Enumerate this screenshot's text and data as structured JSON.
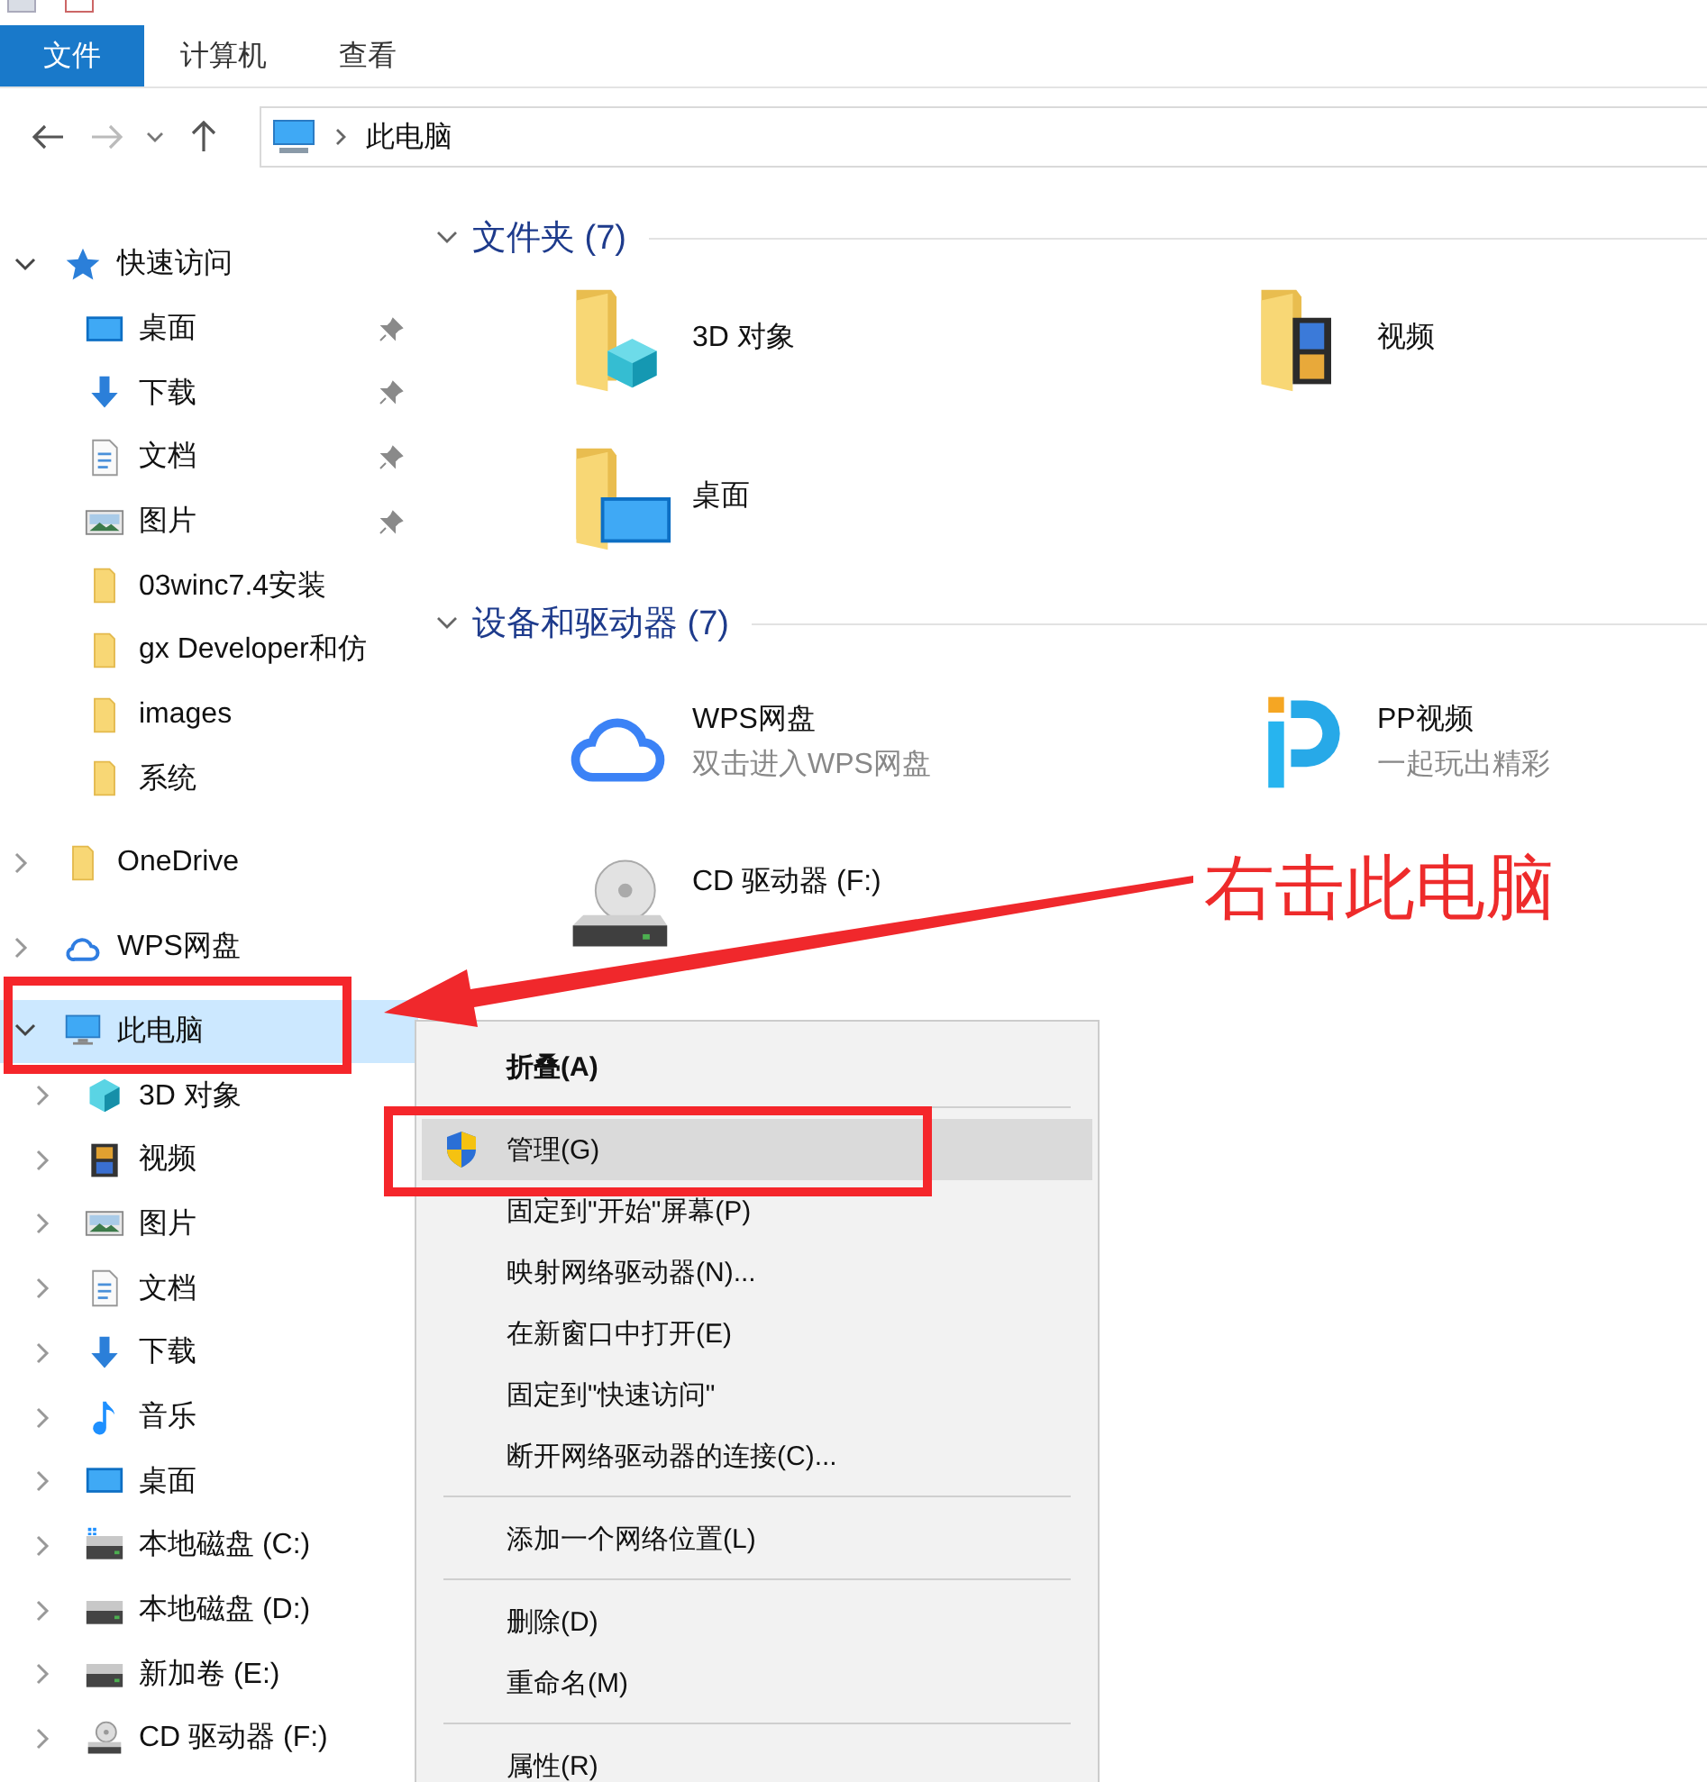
{
  "ribbon": {
    "tabs": [
      {
        "label": "文件",
        "selected": true
      },
      {
        "label": "计算机",
        "selected": false
      },
      {
        "label": "查看",
        "selected": false
      }
    ]
  },
  "address_bar": {
    "segments": [
      "此电脑"
    ]
  },
  "sidebar": {
    "items": [
      {
        "label": "快速访问",
        "kind": "star",
        "expanded": true,
        "selected": false,
        "children": [
          {
            "label": "桌面",
            "kind": "desktop",
            "pinned": true,
            "selected": false
          },
          {
            "label": "下载",
            "kind": "download",
            "pinned": true,
            "selected": false
          },
          {
            "label": "文档",
            "kind": "document",
            "pinned": true,
            "selected": false
          },
          {
            "label": "图片",
            "kind": "picture",
            "pinned": true,
            "selected": false
          },
          {
            "label": "03winc7.4安装",
            "kind": "folder",
            "pinned": false,
            "selected": false
          },
          {
            "label": "gx Developer和仿",
            "kind": "folder",
            "pinned": false,
            "selected": false
          },
          {
            "label": "images",
            "kind": "folder",
            "pinned": false,
            "selected": false
          },
          {
            "label": "系统",
            "kind": "folder",
            "pinned": false,
            "selected": false
          }
        ]
      },
      {
        "label": "OneDrive",
        "kind": "folder",
        "expanded": false,
        "selected": false
      },
      {
        "label": "WPS网盘",
        "kind": "cloud",
        "expanded": false,
        "selected": false
      },
      {
        "label": "此电脑",
        "kind": "pc",
        "expanded": true,
        "selected": true,
        "children": [
          {
            "label": "3D 对象",
            "kind": "cube",
            "expanded": false,
            "selected": false
          },
          {
            "label": "视频",
            "kind": "film",
            "expanded": false,
            "selected": false
          },
          {
            "label": "图片",
            "kind": "picture",
            "expanded": false,
            "selected": false
          },
          {
            "label": "文档",
            "kind": "document",
            "expanded": false,
            "selected": false
          },
          {
            "label": "下载",
            "kind": "download",
            "expanded": false,
            "selected": false
          },
          {
            "label": "音乐",
            "kind": "music",
            "expanded": false,
            "selected": false
          },
          {
            "label": "桌面",
            "kind": "desktop",
            "expanded": false,
            "selected": false
          },
          {
            "label": "本地磁盘 (C:)",
            "kind": "drive-win",
            "expanded": false,
            "selected": false
          },
          {
            "label": "本地磁盘 (D:)",
            "kind": "drive",
            "expanded": false,
            "selected": false
          },
          {
            "label": "新加卷 (E:)",
            "kind": "drive",
            "expanded": false,
            "selected": false
          },
          {
            "label": "CD 驱动器 (F:)",
            "kind": "cd",
            "expanded": false,
            "selected": false
          }
        ]
      }
    ]
  },
  "main": {
    "groups": [
      {
        "title": "文件夹 (7)",
        "expanded": true,
        "items": [
          {
            "name": "3D 对象",
            "kind": "folder-3d"
          },
          {
            "name": "视频",
            "kind": "folder-video"
          },
          {
            "name": "桌面",
            "kind": "folder-desktop"
          }
        ]
      },
      {
        "title": "设备和驱动器 (7)",
        "expanded": true,
        "items": [
          {
            "name": "WPS网盘",
            "detail": "双击进入WPS网盘",
            "kind": "cloud"
          },
          {
            "name": "PP视频",
            "detail": "一起玩出精彩",
            "kind": "pp"
          },
          {
            "name": "CD 驱动器 (F:)",
            "kind": "cd"
          }
        ]
      }
    ]
  },
  "context_menu": {
    "items": [
      {
        "kind": "item",
        "label": "折叠(A)",
        "bold": true,
        "shield": false,
        "selected": false
      },
      {
        "kind": "separator"
      },
      {
        "kind": "item",
        "label": "管理(G)",
        "bold": false,
        "shield": true,
        "selected": true
      },
      {
        "kind": "item",
        "label": "固定到\"开始\"屏幕(P)",
        "bold": false,
        "shield": false,
        "selected": false
      },
      {
        "kind": "item",
        "label": "映射网络驱动器(N)...",
        "bold": false,
        "shield": false,
        "selected": false
      },
      {
        "kind": "item",
        "label": "在新窗口中打开(E)",
        "bold": false,
        "shield": false,
        "selected": false
      },
      {
        "kind": "item",
        "label": "固定到\"快速访问\"",
        "bold": false,
        "shield": false,
        "selected": false
      },
      {
        "kind": "item",
        "label": "断开网络驱动器的连接(C)...",
        "bold": false,
        "shield": false,
        "selected": false
      },
      {
        "kind": "separator"
      },
      {
        "kind": "item",
        "label": "添加一个网络位置(L)",
        "bold": false,
        "shield": false,
        "selected": false
      },
      {
        "kind": "separator"
      },
      {
        "kind": "item",
        "label": "删除(D)",
        "bold": false,
        "shield": false,
        "selected": false
      },
      {
        "kind": "item",
        "label": "重命名(M)",
        "bold": false,
        "shield": false,
        "selected": false
      },
      {
        "kind": "separator"
      },
      {
        "kind": "item",
        "label": "属性(R)",
        "bold": false,
        "shield": false,
        "selected": false
      }
    ]
  },
  "annotation": {
    "callout": "右击此电脑"
  }
}
